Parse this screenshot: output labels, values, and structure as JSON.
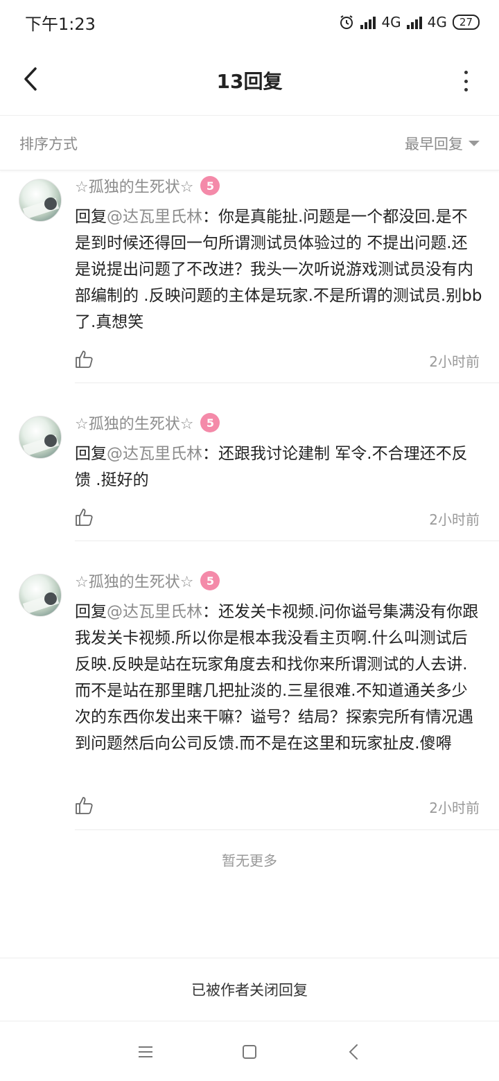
{
  "status": {
    "time": "下午1:23",
    "net1": "4G",
    "net2": "4G",
    "battery": "27"
  },
  "header": {
    "title": "13回复"
  },
  "sort": {
    "label": "排序方式",
    "selected": "最早回复"
  },
  "replies": [
    {
      "username": "☆孤独的生死状☆",
      "badge": "5",
      "prefix": "回复",
      "mention": "@达瓦里氏林",
      "text": "：你是真能扯.问题是一个都没回.是不是到时候还得回一句所谓测试员体验过的 不提出问题.还是说提出问题了不改进？我头一次听说游戏测试员没有内部编制的 .反映问题的主体是玩家.不是所谓的测试员.别bb了.真想笑",
      "time": "2小时前"
    },
    {
      "username": "☆孤独的生死状☆",
      "badge": "5",
      "prefix": "回复",
      "mention": "@达瓦里氏林",
      "text": "：还跟我讨论建制 军令.不合理还不反馈 .挺好的",
      "time": "2小时前"
    },
    {
      "username": "☆孤独的生死状☆",
      "badge": "5",
      "prefix": "回复",
      "mention": "@达瓦里氏林",
      "text": "：还发关卡视频.问你谥号集满没有你跟我发关卡视频.所以你是根本我没看主页啊.什么叫测试后反映.反映是站在玩家角度去和找你来所谓测试的人去讲.而不是站在那里瞎几把扯淡的.三星很难.不知道通关多少次的东西你发出来干嘛？谥号？结局？探索完所有情况遇到问题然后向公司反馈.而不是在这里和玩家扯皮.傻嘚",
      "time": "2小时前"
    }
  ],
  "footer": {
    "no_more": "暂无更多",
    "closed": "已被作者关闭回复"
  },
  "colors": {
    "badge": "#f48aa9",
    "muted": "#8c8c8c"
  }
}
